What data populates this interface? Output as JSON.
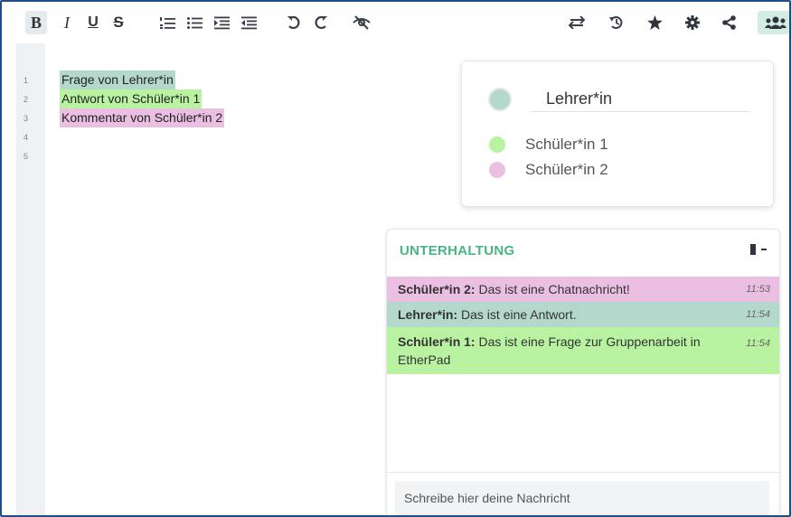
{
  "toolbar": {
    "bold_label": "B",
    "buttons": [
      "bold",
      "italic",
      "underline",
      "strikethrough",
      "ordered-list",
      "unordered-list",
      "indent",
      "outdent",
      "undo",
      "redo",
      "eye-off",
      "import-export",
      "timeslider",
      "star",
      "settings",
      "share",
      "users"
    ]
  },
  "editor": {
    "line_numbers": [
      "1",
      "2",
      "3",
      "4",
      "5"
    ],
    "lines": [
      {
        "text": "Frage von Lehrer*in",
        "color": "#b4d9cc"
      },
      {
        "text": "Antwort von Schüler*in 1",
        "color": "#b9f3a1"
      },
      {
        "text": "Kommentar von Schüler*in 2",
        "color": "#ebbfe2"
      }
    ]
  },
  "users_panel": {
    "self_name": "Lehrer*in",
    "self_color": "#b4d9cc",
    "others": [
      {
        "name": "Schüler*in 1",
        "color": "#b9f3a1"
      },
      {
        "name": "Schüler*in 2",
        "color": "#ebbfe2"
      }
    ]
  },
  "chat": {
    "title": "UNTERHALTUNG",
    "messages": [
      {
        "author": "Schüler*in 2:",
        "text": " Das ist eine Chatnachricht!",
        "time": "11:53",
        "color": "#ebbfe2"
      },
      {
        "author": "Lehrer*in:",
        "text": " Das ist eine Antwort.",
        "time": "11:54",
        "color": "#b4d9cc"
      },
      {
        "author": "Schüler*in 1:",
        "text": " Das ist eine Frage zur Gruppenarbeit in EtherPad",
        "time": "11:54",
        "color": "#b9f3a1"
      }
    ],
    "input_placeholder": "Schreibe hier deine Nachricht"
  }
}
